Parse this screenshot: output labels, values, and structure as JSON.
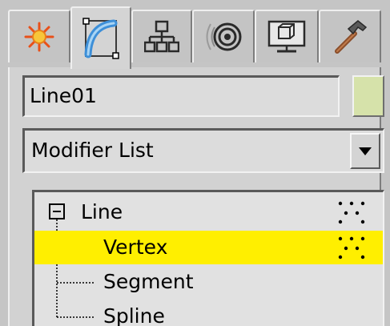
{
  "tabs": [
    {
      "name": "create",
      "icon": "sun-burst-icon"
    },
    {
      "name": "modify",
      "icon": "curve-modify-icon",
      "active": true
    },
    {
      "name": "hierarchy",
      "icon": "hierarchy-icon"
    },
    {
      "name": "motion",
      "icon": "motion-target-icon"
    },
    {
      "name": "display",
      "icon": "monitor-display-icon"
    },
    {
      "name": "utilities",
      "icon": "hammer-icon"
    }
  ],
  "object": {
    "name": "Line01",
    "color": "#d6e2aa"
  },
  "modifier_list": {
    "selected": "Modifier List"
  },
  "stack": {
    "root": "Line",
    "items": [
      "Vertex",
      "Segment",
      "Spline"
    ],
    "selected_index": 0
  },
  "colors": {
    "selection": "#ffef00",
    "panel": "#d2d2d2"
  }
}
